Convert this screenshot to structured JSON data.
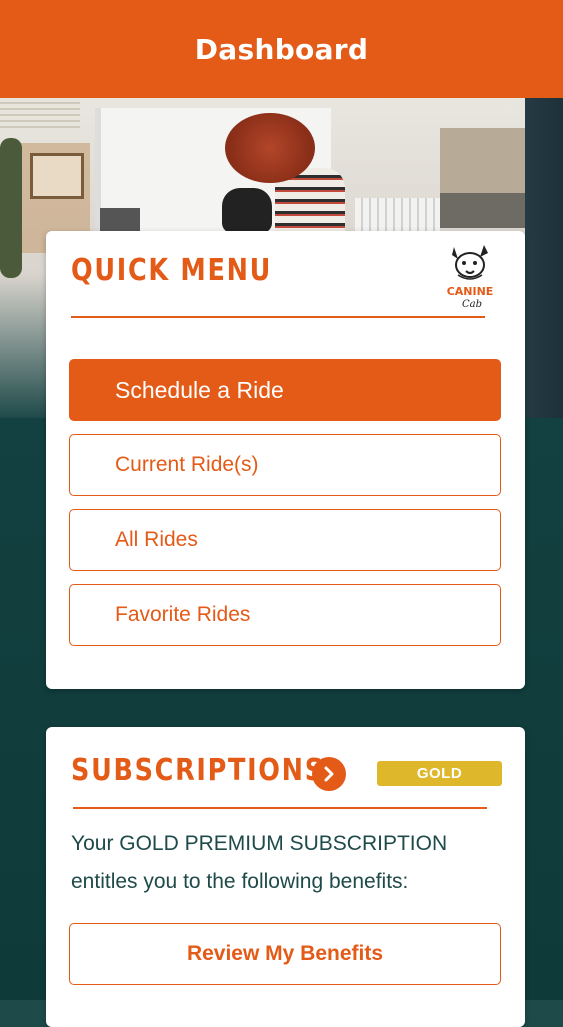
{
  "header": {
    "title": "Dashboard"
  },
  "quick_menu": {
    "title": "QUICK MENU",
    "logo": {
      "line1": "CANINE",
      "line2": "Cab"
    },
    "buttons": [
      {
        "label": "Schedule a Ride"
      },
      {
        "label": "Current Ride(s)"
      },
      {
        "label": "All Rides"
      },
      {
        "label": "Favorite Rides"
      }
    ]
  },
  "subscriptions": {
    "title": "SUBSCRIPTIONS",
    "badge": "GOLD",
    "description": "Your GOLD PREMIUM SUBSCRIPTION entitles you to the following benefits:",
    "review_label": "Review My Benefits"
  },
  "colors": {
    "accent": "#e45a17",
    "gold": "#dfb72b",
    "teal_text": "#1f4a4a",
    "background": "#134040"
  }
}
